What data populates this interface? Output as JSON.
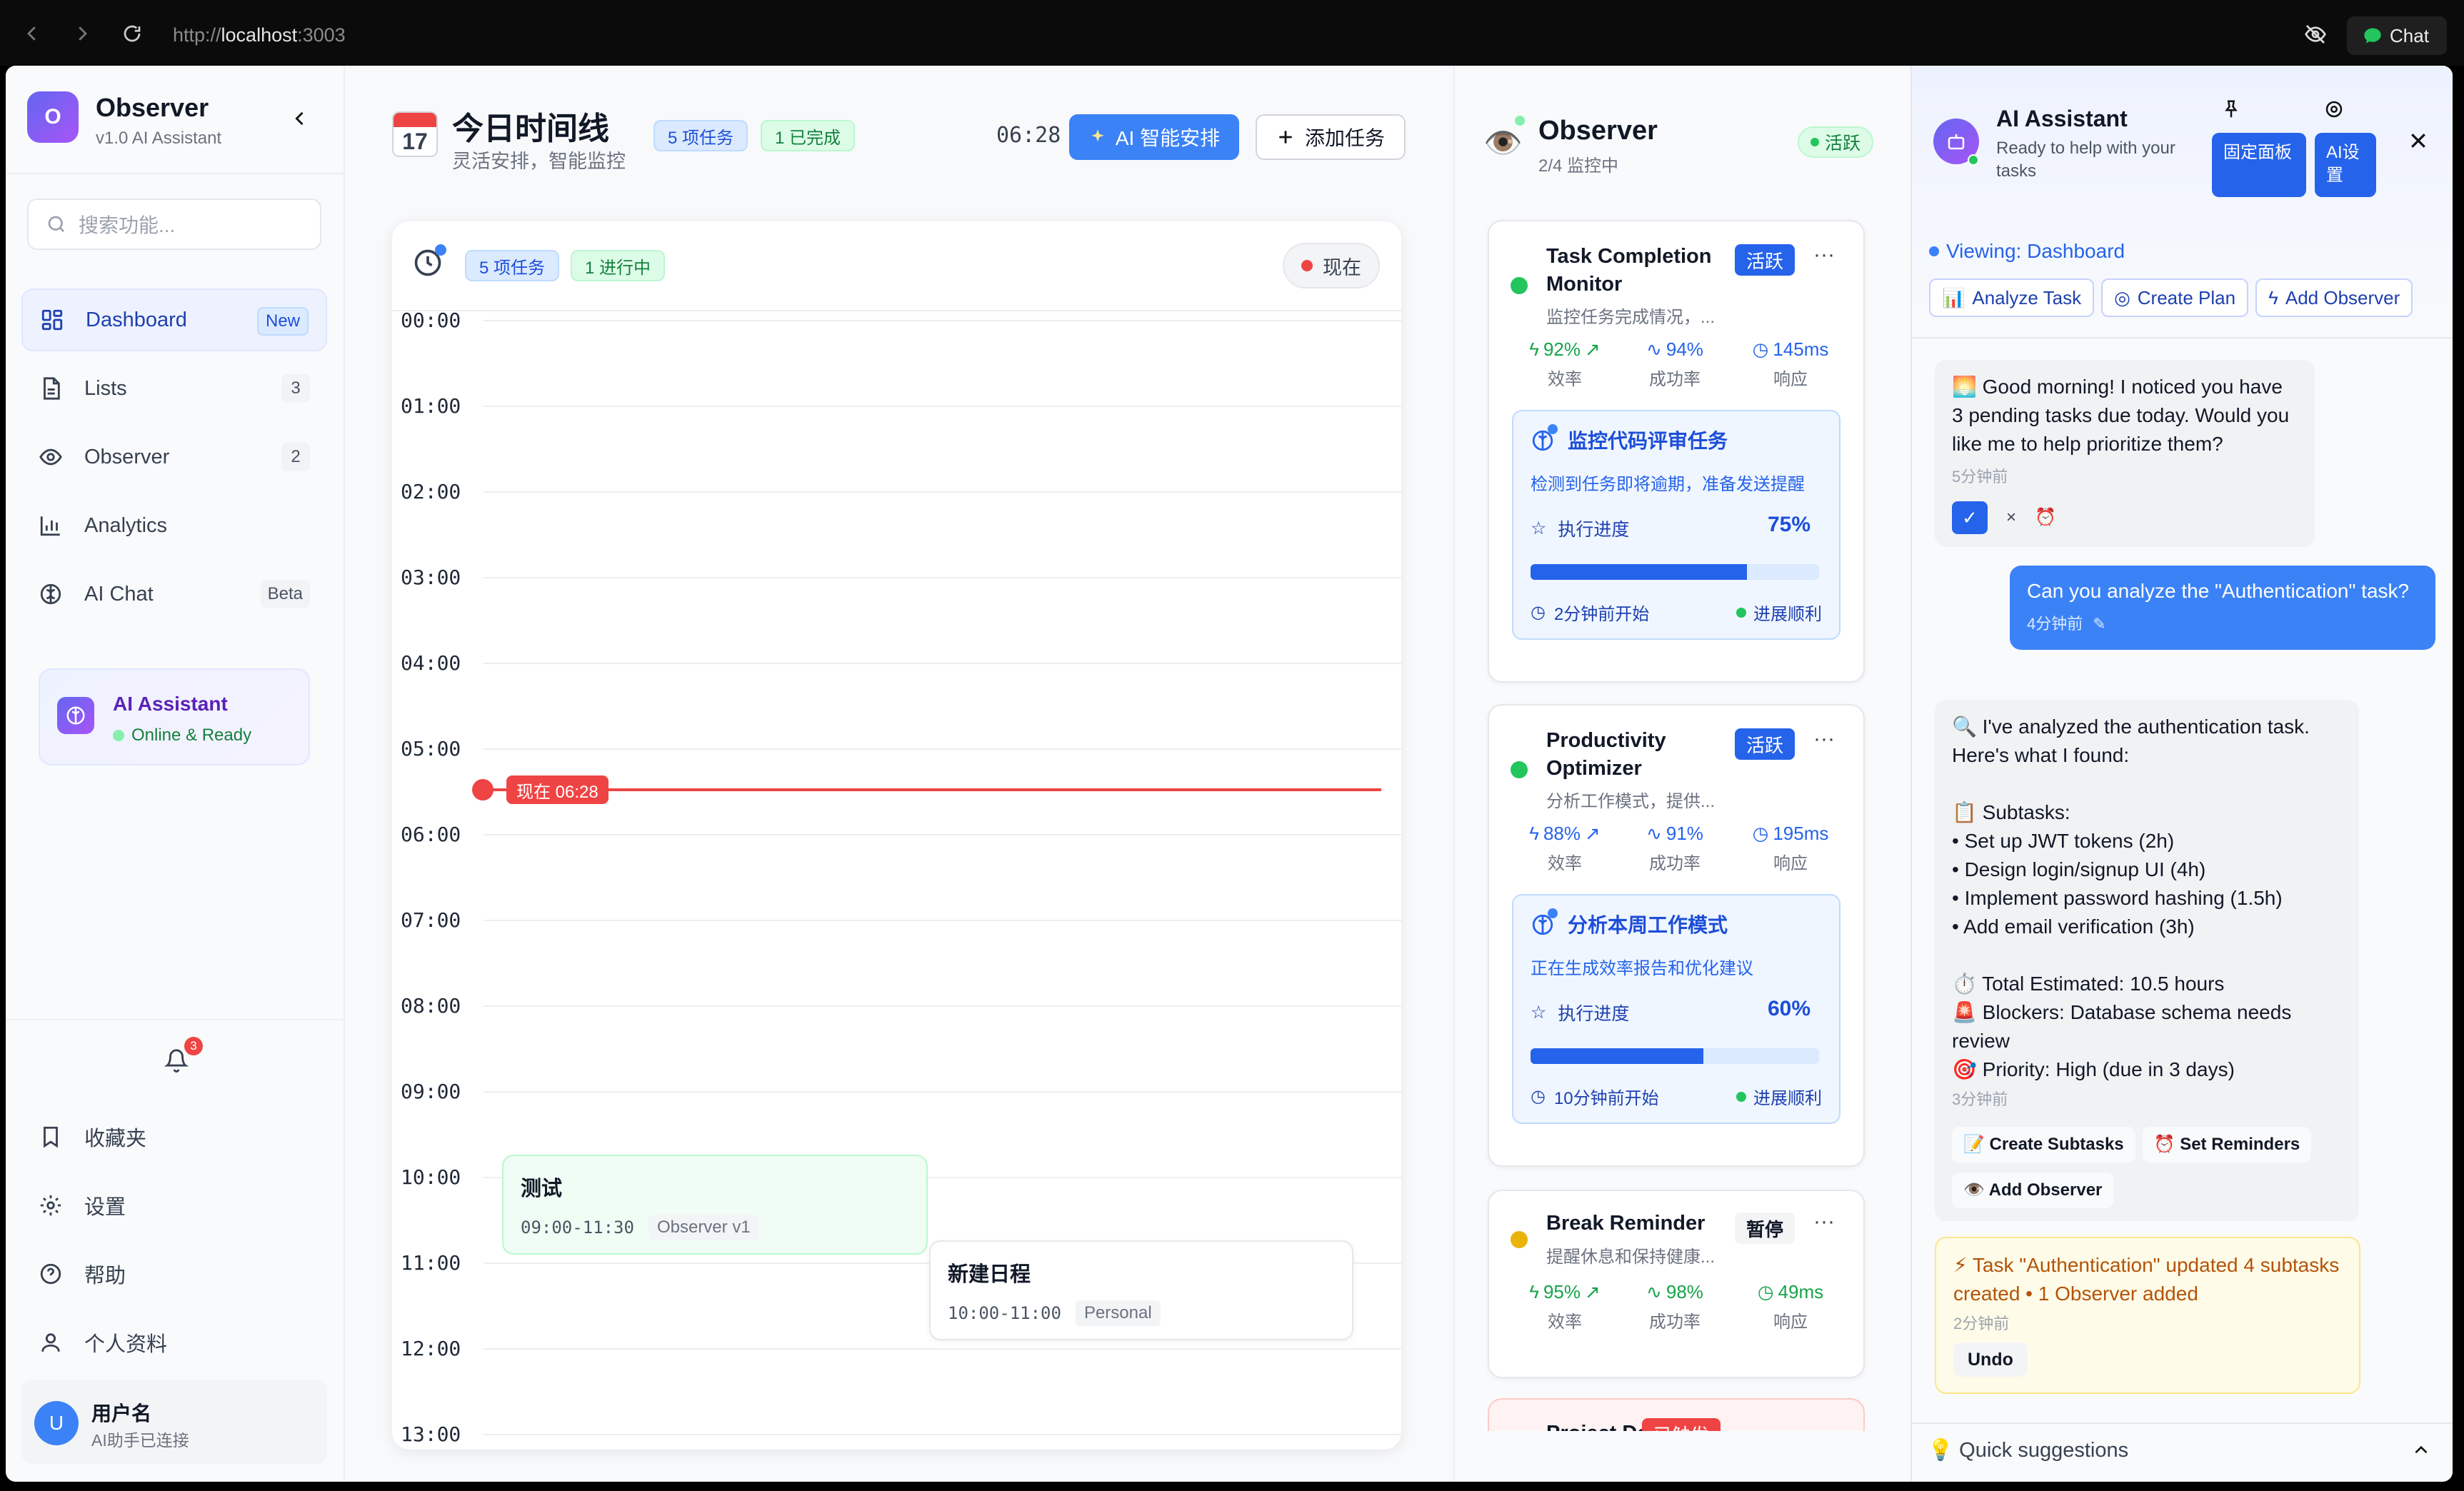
{
  "browser": {
    "url_prefix": "http://",
    "url_host": "localhost",
    "url_port": ":3003",
    "chat_label": "Chat"
  },
  "sidebar": {
    "logo_letter": "O",
    "brand": "Observer",
    "version": "v1.0 AI Assistant",
    "search_placeholder": "搜索功能...",
    "items": [
      {
        "label": "Dashboard",
        "badge": "New"
      },
      {
        "label": "Lists",
        "badge": "3"
      },
      {
        "label": "Observer",
        "badge": "2"
      },
      {
        "label": "Analytics",
        "badge": ""
      },
      {
        "label": "AI Chat",
        "badge": "Beta"
      }
    ],
    "ai_card": {
      "title": "AI Assistant",
      "status": "Online & Ready"
    },
    "notification_count": "3",
    "bottom": [
      {
        "label": "收藏夹"
      },
      {
        "label": "设置"
      },
      {
        "label": "帮助"
      },
      {
        "label": "个人资料"
      }
    ],
    "user": {
      "initial": "U",
      "name": "用户名",
      "status": "AI助手已连接"
    }
  },
  "timeline": {
    "calendar_day": "17",
    "title": "今日时间线",
    "subtitle": "灵活安排，智能监控",
    "chip_tasks": "5 项任务",
    "chip_done": "1 已完成",
    "clock": "06:28",
    "ai_button": "AI 智能安排",
    "add_button": "添加任务",
    "card_chip_tasks": "5 项任务",
    "card_chip_progress": "1 进行中",
    "now_button": "现在",
    "now_marker": "现在 06:28",
    "hours": [
      "00:00",
      "01:00",
      "02:00",
      "03:00",
      "04:00",
      "05:00",
      "06:00",
      "07:00",
      "08:00",
      "09:00",
      "10:00",
      "11:00",
      "12:00",
      "13:00"
    ],
    "events": [
      {
        "title": "测试",
        "time": "09:00-11:30",
        "tag": "Observer v1"
      },
      {
        "title": "新建日程",
        "time": "10:00-11:00",
        "tag": "Personal"
      }
    ]
  },
  "observer": {
    "title": "Observer",
    "subtitle": "2/4 监控中",
    "status": "活跃",
    "cards": [
      {
        "name": "Task Completion Monitor",
        "desc": "监控任务完成情况，...",
        "badge": "活跃",
        "eff": "92%",
        "eff_label": "效率",
        "succ": "94%",
        "succ_label": "成功率",
        "resp": "145ms",
        "resp_label": "响应",
        "task": {
          "title": "监控代码评审任务",
          "desc": "检测到任务即将逾期，准备发送提醒",
          "progress_label": "执行进度",
          "progress": "75%",
          "progress_value": 0.75,
          "started": "2分钟前开始",
          "state": "进展顺利"
        }
      },
      {
        "name": "Productivity Optimizer",
        "desc": "分析工作模式，提供...",
        "badge": "活跃",
        "eff": "88%",
        "eff_label": "效率",
        "succ": "91%",
        "succ_label": "成功率",
        "resp": "195ms",
        "resp_label": "响应",
        "task": {
          "title": "分析本周工作模式",
          "desc": "正在生成效率报告和优化建议",
          "progress_label": "执行进度",
          "progress": "60%",
          "progress_value": 0.6,
          "started": "10分钟前开始",
          "state": "进展顺利"
        }
      },
      {
        "name": "Break Reminder",
        "desc": "提醒休息和保持健康...",
        "badge": "暂停",
        "eff": "95%",
        "eff_label": "效率",
        "succ": "98%",
        "succ_label": "成功率",
        "resp": "49ms",
        "resp_label": "响应"
      },
      {
        "name": "Project Deadline",
        "badge": "已触发"
      }
    ]
  },
  "assistant": {
    "title": "AI Assistant",
    "subtitle": "Ready to help with your tasks",
    "pin_label": "固定面板",
    "settings_label": "AI设置",
    "viewing": "Viewing: Dashboard",
    "actions": [
      "Analyze Task",
      "Create Plan",
      "Add Observer"
    ],
    "msg1": {
      "text": "🌅 Good morning! I noticed you have 3 pending tasks due today. Would you like me to help prioritize them?",
      "time": "5分钟前"
    },
    "msg2": {
      "text": "Can you analyze the \"Authentication\" task?",
      "time": "4分钟前"
    },
    "msg3": {
      "lines": [
        "🔍 I've analyzed the authentication task.",
        "Here's what I found:",
        "",
        "📋 Subtasks:",
        "• Set up JWT tokens (2h)",
        "• Design login/signup UI (4h)",
        "• Implement password hashing (1.5h)",
        "• Add email verification (3h)",
        "",
        "⏱️ Total Estimated: 10.5 hours",
        "🚨 Blockers: Database schema needs",
        "review",
        "🎯 Priority: High (due in 3 days)"
      ],
      "time": "3分钟前",
      "buttons": [
        "📝 Create Subtasks",
        "⏰ Set Reminders",
        "👁️ Add Observer"
      ]
    },
    "update": {
      "text": "⚡ Task \"Authentication\" updated 4 subtasks created • 1 Observer added",
      "time": "2分钟前",
      "undo": "Undo"
    },
    "suggestions": "💡 Quick suggestions",
    "colors": {
      "accent": "#3b82f6",
      "active": "#2563eb",
      "success": "#22c55e",
      "danger": "#ef4444"
    }
  }
}
